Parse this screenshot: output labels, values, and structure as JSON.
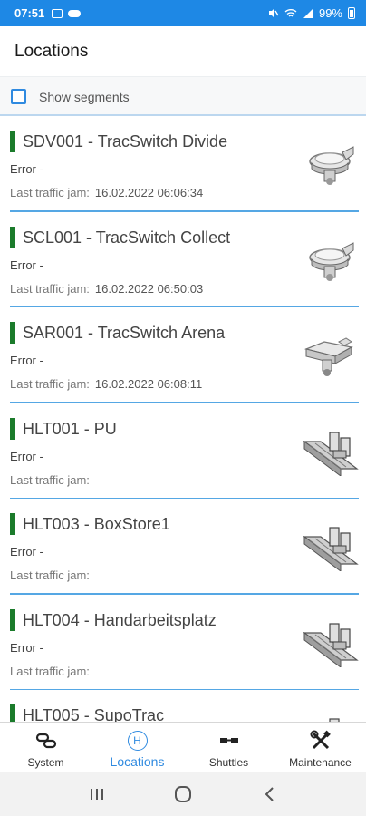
{
  "status_bar": {
    "time": "07:51",
    "battery": "99%",
    "icons": [
      "gallery-icon",
      "cloud-icon",
      "mute-icon",
      "wifi-icon",
      "signal-icon",
      "battery-icon"
    ]
  },
  "header": {
    "title": "Locations"
  },
  "segments": {
    "label": "Show segments",
    "checked": false
  },
  "list": {
    "items": [
      {
        "name": "SDV001 - TracSwitch Divide",
        "error": "Error -",
        "jam_label": "Last traffic jam:",
        "jam_value": "16.02.2022 06:06:34",
        "status_color": "#1b7b2b",
        "thumb": "tracswitch-icon"
      },
      {
        "name": "SCL001 - TracSwitch Collect",
        "error": "Error -",
        "jam_label": "Last traffic jam:",
        "jam_value": "16.02.2022 06:50:03",
        "status_color": "#1b7b2b",
        "thumb": "tracswitch-icon"
      },
      {
        "name": "SAR001 - TracSwitch Arena",
        "error": "Error -",
        "jam_label": "Last traffic jam:",
        "jam_value": "16.02.2022 06:08:11",
        "status_color": "#1b7b2b",
        "thumb": "tracswitch-arena-icon"
      },
      {
        "name": "HLT001 - PU",
        "error": "Error -",
        "jam_label": "Last traffic jam:",
        "jam_value": "",
        "status_color": "#1b7b2b",
        "thumb": "rail-stop-icon"
      },
      {
        "name": "HLT003 - BoxStore1",
        "error": "Error -",
        "jam_label": "Last traffic jam:",
        "jam_value": "",
        "status_color": "#1b7b2b",
        "thumb": "rail-stop-icon"
      },
      {
        "name": "HLT004 - Handarbeitsplatz",
        "error": "Error -",
        "jam_label": "Last traffic jam:",
        "jam_value": "",
        "status_color": "#1b7b2b",
        "thumb": "rail-stop-icon"
      },
      {
        "name": "HLT005 - SupoTrac",
        "error": "",
        "jam_label": "",
        "jam_value": "",
        "status_color": "#1b7b2b",
        "thumb": "rail-stop-icon"
      }
    ]
  },
  "bottom_nav": {
    "tabs": [
      {
        "label": "System",
        "icon": "link-icon",
        "active": false
      },
      {
        "label": "Locations",
        "icon": "h-circle-icon",
        "active": true
      },
      {
        "label": "Shuttles",
        "icon": "shuttle-icon",
        "active": false
      },
      {
        "label": "Maintenance",
        "icon": "tools-icon",
        "active": false
      }
    ],
    "accent": "#2f8ae0"
  },
  "system_nav": {
    "buttons": [
      "recents-icon",
      "home-icon",
      "back-icon"
    ]
  }
}
